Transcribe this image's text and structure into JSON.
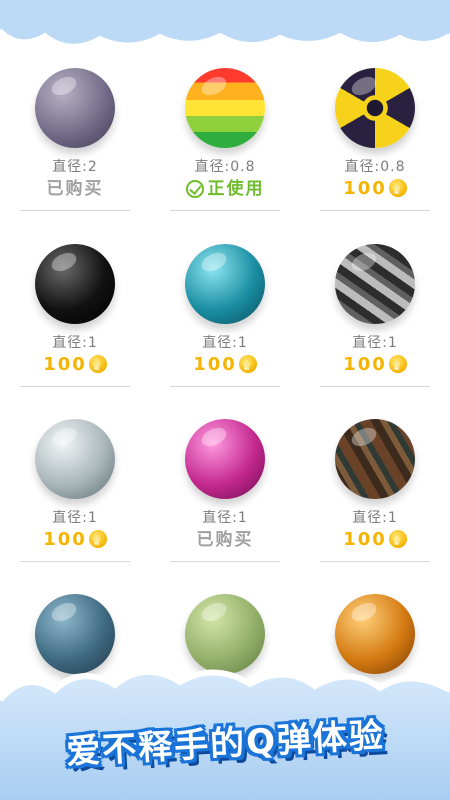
{
  "colors": {
    "sky_blue": "#bcd9f5",
    "price_gold": "#f4b400",
    "in_use_green": "#6fbd2c",
    "owned_gray": "#a0a0a0",
    "banner_blue": "#1b74d8"
  },
  "diameter_label": "直径:",
  "balls": [
    {
      "icon": "purple-moon-ball-icon",
      "diameter": "直径:2",
      "status": "已购买",
      "type": "owned"
    },
    {
      "icon": "rainbow-ball-icon",
      "diameter": "直径:0.8",
      "status": "正使用",
      "type": "in-use"
    },
    {
      "icon": "radiation-ball-icon",
      "diameter": "直径:0.8",
      "status": "100",
      "type": "price"
    },
    {
      "icon": "black-glass-ball-icon",
      "diameter": "直径:1",
      "status": "100",
      "type": "price"
    },
    {
      "icon": "teal-glass-ball-icon",
      "diameter": "直径:1",
      "status": "100",
      "type": "price"
    },
    {
      "icon": "metal-ball-icon",
      "diameter": "直径:1",
      "status": "100",
      "type": "price"
    },
    {
      "icon": "pearl-ball-icon",
      "diameter": "直径:1",
      "status": "100",
      "type": "price"
    },
    {
      "icon": "gem-ball-icon",
      "diameter": "直径:1",
      "status": "已购买",
      "type": "owned"
    },
    {
      "icon": "wood-ball-icon",
      "diameter": "直径:1",
      "status": "100",
      "type": "price"
    },
    {
      "icon": "stone-ball-icon"
    },
    {
      "icon": "jade-ball-icon"
    },
    {
      "icon": "amber-ball-icon"
    }
  ],
  "banner": {
    "text": "爱不释手的Q弹体验"
  }
}
